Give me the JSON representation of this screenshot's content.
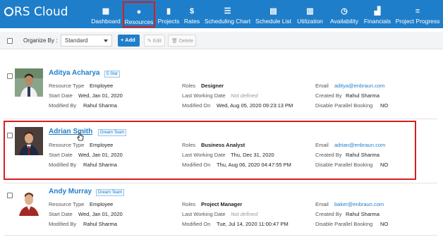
{
  "app": {
    "title": "eRS Cloud",
    "logo_letter": "e",
    "logo_rest": "RS Cloud"
  },
  "nav": [
    {
      "label": "Dashboard",
      "icon": "bar-chart-icon",
      "glyph": "▦"
    },
    {
      "label": "Resources",
      "icon": "user-icon",
      "glyph": "●"
    },
    {
      "label": "Projects",
      "icon": "document-icon",
      "glyph": "▮"
    },
    {
      "label": "Rates",
      "icon": "dollar-icon",
      "glyph": "$"
    },
    {
      "label": "Scheduling Chart",
      "icon": "chart-bars-icon",
      "glyph": "☰"
    },
    {
      "label": "Schedule List",
      "icon": "list-icon",
      "glyph": "▤"
    },
    {
      "label": "Utilization",
      "icon": "column-chart-icon",
      "glyph": "▥"
    },
    {
      "label": "Availability",
      "icon": "clock-icon",
      "glyph": "◷"
    },
    {
      "label": "Financials",
      "icon": "financial-chart-icon",
      "glyph": "▟"
    },
    {
      "label": "Project Progress",
      "icon": "progress-icon",
      "glyph": "≡"
    }
  ],
  "active_nav": "Resources",
  "toolbar": {
    "organize_label": "Organize By :",
    "organize_value": "Standard",
    "add_label": "+ Add",
    "edit_label": "Edit",
    "delete_label": "Delete"
  },
  "labels": {
    "resource_type": "Resource Type",
    "start_date": "Start Date",
    "modified_by": "Modified By",
    "roles": "Roles",
    "last_working_date": "Last Working Date",
    "modified_on": "Modified On",
    "email": "Email",
    "created_by": "Created By",
    "disable_parallel": "Disable Parallel Booking"
  },
  "resources": [
    {
      "name": "Aditya Acharya",
      "badge": "5 Star",
      "resource_type": "Employee",
      "start_date": "Wed, Jan 01, 2020",
      "modified_by": "Rahul Sharma",
      "roles": "Designer",
      "last_working_date": "Not defined",
      "modified_on": "Wed, Aug 05, 2020 09:23:13 PM",
      "email": "aditya@enbraun.com",
      "created_by": "Rahul Sharma",
      "disable_parallel": "NO"
    },
    {
      "name": "Adrian Smith",
      "badge": "Dream Team",
      "resource_type": "Employee",
      "start_date": "Wed, Jan 01, 2020",
      "modified_by": "Rahul Sharma",
      "roles": "Business Analyst",
      "last_working_date": "Thu, Dec 31, 2020",
      "modified_on": "Thu, Aug 06, 2020 04:47:55 PM",
      "email": "adrian@enbraun.com",
      "created_by": "Rahul Sharma",
      "disable_parallel": "NO"
    },
    {
      "name": "Andy Murray",
      "badge": "Dream Team",
      "resource_type": "Employee",
      "start_date": "Wed, Jan 01, 2020",
      "modified_by": "Rahul Sharma",
      "roles": "Project Manager",
      "last_working_date": "Not defined",
      "modified_on": "Tue, Jul 14, 2020 11:00:47 PM",
      "email": "baker@enbraun.com",
      "created_by": "Rahul Sharma",
      "disable_parallel": "NO"
    }
  ],
  "colors": {
    "brand": "#1f7ec9",
    "highlight": "#d81e1e",
    "link": "#1f7ec9"
  }
}
